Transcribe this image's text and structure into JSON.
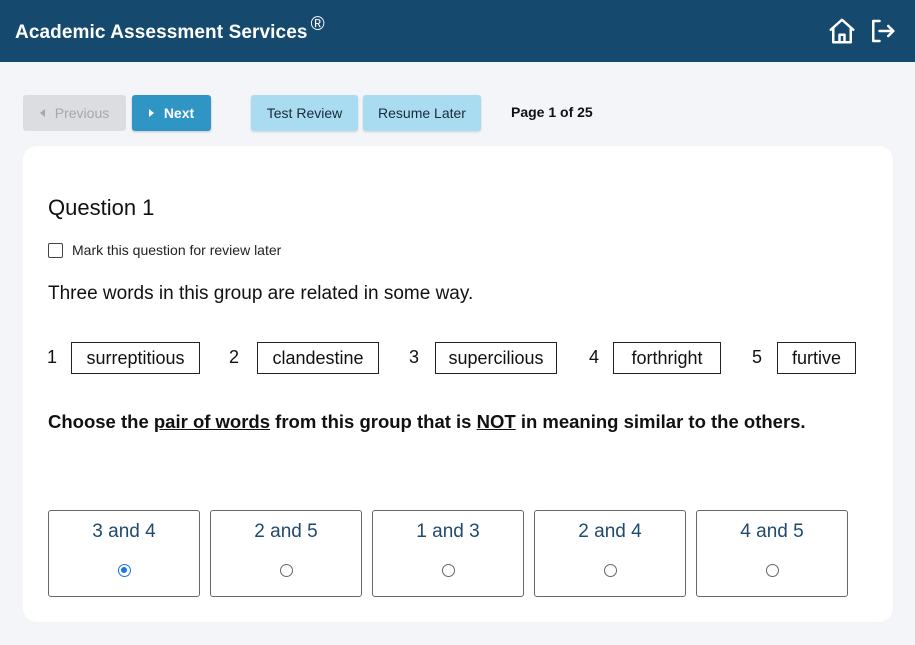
{
  "header": {
    "title": "Academic Assessment Services",
    "registered_mark": "®",
    "background_color": "#154a6e",
    "icons": [
      "home-icon",
      "logout-icon"
    ]
  },
  "toolbar": {
    "previous_label": "Previous",
    "next_label": "Next",
    "test_review_label": "Test Review",
    "resume_later_label": "Resume Later",
    "page_indicator": "Page 1 of 25"
  },
  "question": {
    "title": "Question 1",
    "mark_for_review_label": "Mark this question for review later",
    "mark_for_review_checked": false,
    "prompt": "Three words in this group are related in some way.",
    "words": [
      {
        "number": "1",
        "word": "surreptitious"
      },
      {
        "number": "2",
        "word": "clandestine"
      },
      {
        "number": "3",
        "word": "supercilious"
      },
      {
        "number": "4",
        "word": "forthright"
      },
      {
        "number": "5",
        "word": "furtive"
      }
    ],
    "instruction": {
      "part1": "Choose the ",
      "underline1": "pair of words",
      "part2": " from this group that is ",
      "underline2": "NOT",
      "part3": " in meaning similar to the others."
    },
    "options": [
      {
        "label": "3 and 4",
        "selected": true
      },
      {
        "label": "2 and 5",
        "selected": false
      },
      {
        "label": "1 and 3",
        "selected": false
      },
      {
        "label": "2 and 4",
        "selected": false
      },
      {
        "label": "4 and 5",
        "selected": false
      }
    ]
  }
}
